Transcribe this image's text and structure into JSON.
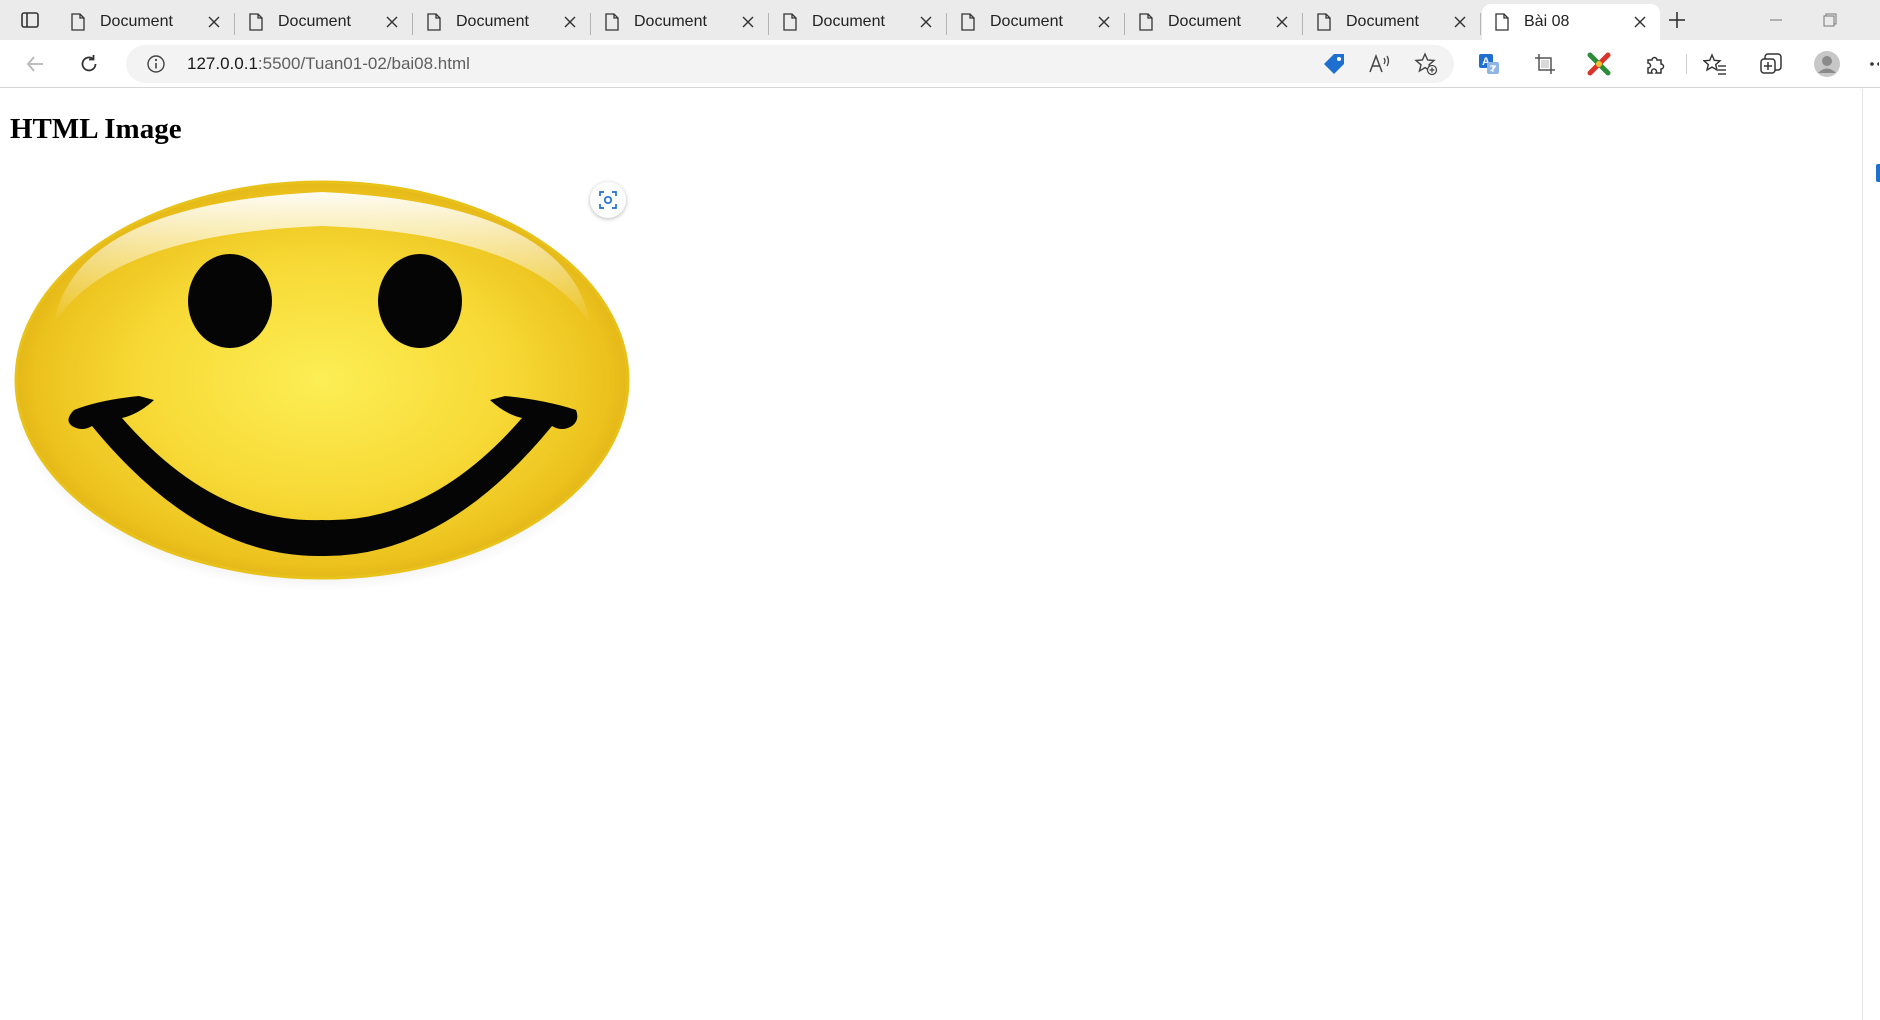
{
  "tabs": [
    {
      "title": "Document",
      "active": false
    },
    {
      "title": "Document",
      "active": false
    },
    {
      "title": "Document",
      "active": false
    },
    {
      "title": "Document",
      "active": false
    },
    {
      "title": "Document",
      "active": false
    },
    {
      "title": "Document",
      "active": false
    },
    {
      "title": "Document",
      "active": false
    },
    {
      "title": "Document",
      "active": false
    },
    {
      "title": "Bài 08",
      "active": true
    }
  ],
  "address_bar": {
    "host": "127.0.0.1",
    "rest": ":5500/Tuan01-02/bai08.html"
  },
  "icons": {
    "tab_actions": "tab-actions-icon",
    "back": "back-arrow-icon",
    "refresh": "refresh-icon",
    "site_info": "info-icon",
    "shopping": "shopping-tag-icon",
    "read_aloud": "read-aloud-icon",
    "add_favorite": "add-favorite-icon",
    "translate": "translate-icon",
    "screenshot": "web-capture-icon",
    "extension_tool": "extension-tool-icon",
    "extensions": "extensions-puzzle-icon",
    "favorites": "favorites-icon",
    "collections": "collections-icon",
    "profile": "profile-avatar-icon",
    "more": "more-icon",
    "visual_search": "visual-search-icon"
  },
  "colors": {
    "tabstrip_bg": "#ebebeb",
    "accent_blue": "#1f6fd1",
    "smiley_yellow": "#f7d935"
  },
  "page": {
    "heading": "HTML Image"
  }
}
